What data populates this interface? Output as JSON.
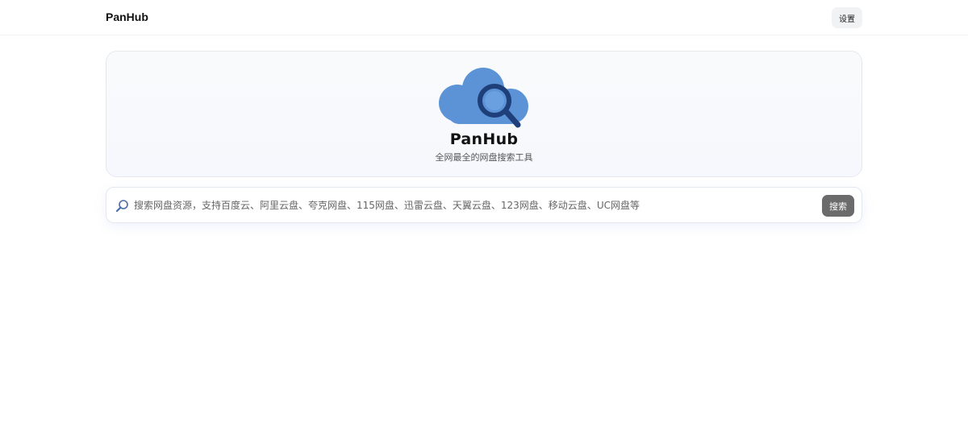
{
  "header": {
    "brand": "PanHub",
    "settings_label": "设置"
  },
  "hero": {
    "logo_icon": "cloud-magnifier-icon",
    "logo_text": "PanHub",
    "tagline": "全网最全的网盘搜索工具"
  },
  "search": {
    "icon": "magnifier-icon",
    "placeholder": "搜索网盘资源，支持百度云、阿里云盘、夸克网盘、115网盘、迅雷云盘、天翼云盘、123网盘、移动云盘、UC网盘等",
    "value": "",
    "button_label": "搜索"
  },
  "colors": {
    "cloud": "#5b93d6",
    "lens_ring": "#1f3f7a",
    "search_button": "#6b6b6b"
  }
}
